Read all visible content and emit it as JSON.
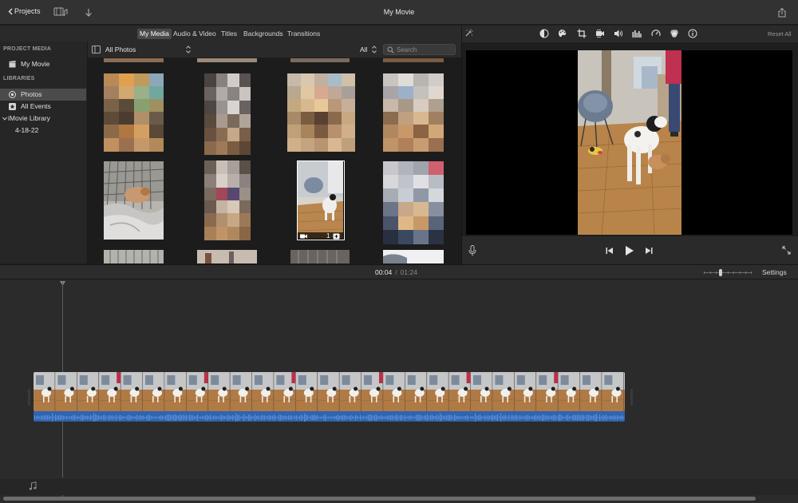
{
  "titlebar": {
    "back_label": "Projects",
    "title": "My Movie"
  },
  "browser": {
    "tabs": [
      {
        "label": "My Media",
        "active": true
      },
      {
        "label": "Audio & Video",
        "active": false
      },
      {
        "label": "Titles",
        "active": false
      },
      {
        "label": "Backgrounds",
        "active": false
      },
      {
        "label": "Transitions",
        "active": false
      }
    ],
    "source_label": "All Photos",
    "filter_label": "All",
    "search_placeholder": "Search"
  },
  "sidebar": {
    "project_media_heading": "PROJECT MEDIA",
    "project_item": "My Movie",
    "libraries_heading": "LIBRARIES",
    "items": [
      {
        "label": "Photos",
        "icon": "photos-icon",
        "selected": true
      },
      {
        "label": "All Events",
        "icon": "star-icon",
        "selected": false
      }
    ],
    "library_label": "iMovie Library",
    "event_label": "4-18-22"
  },
  "grid": {
    "selected_clip_duration_fragment": "1"
  },
  "viewer": {
    "reset_label": "Reset All",
    "tools": [
      "magic-wand-icon",
      "color-balance-icon",
      "color-correction-icon",
      "crop-icon",
      "stabilization-icon",
      "volume-icon",
      "equalizer-icon",
      "speed-icon",
      "filter-icon",
      "info-icon"
    ]
  },
  "timeline": {
    "current_time": "00:04",
    "separator": "/",
    "duration": "01:24",
    "settings_label": "Settings"
  },
  "colors": {
    "accent": "#4b4b4b",
    "audio_waveform": "#2f64b0",
    "clip_floor": "#b07a45"
  }
}
